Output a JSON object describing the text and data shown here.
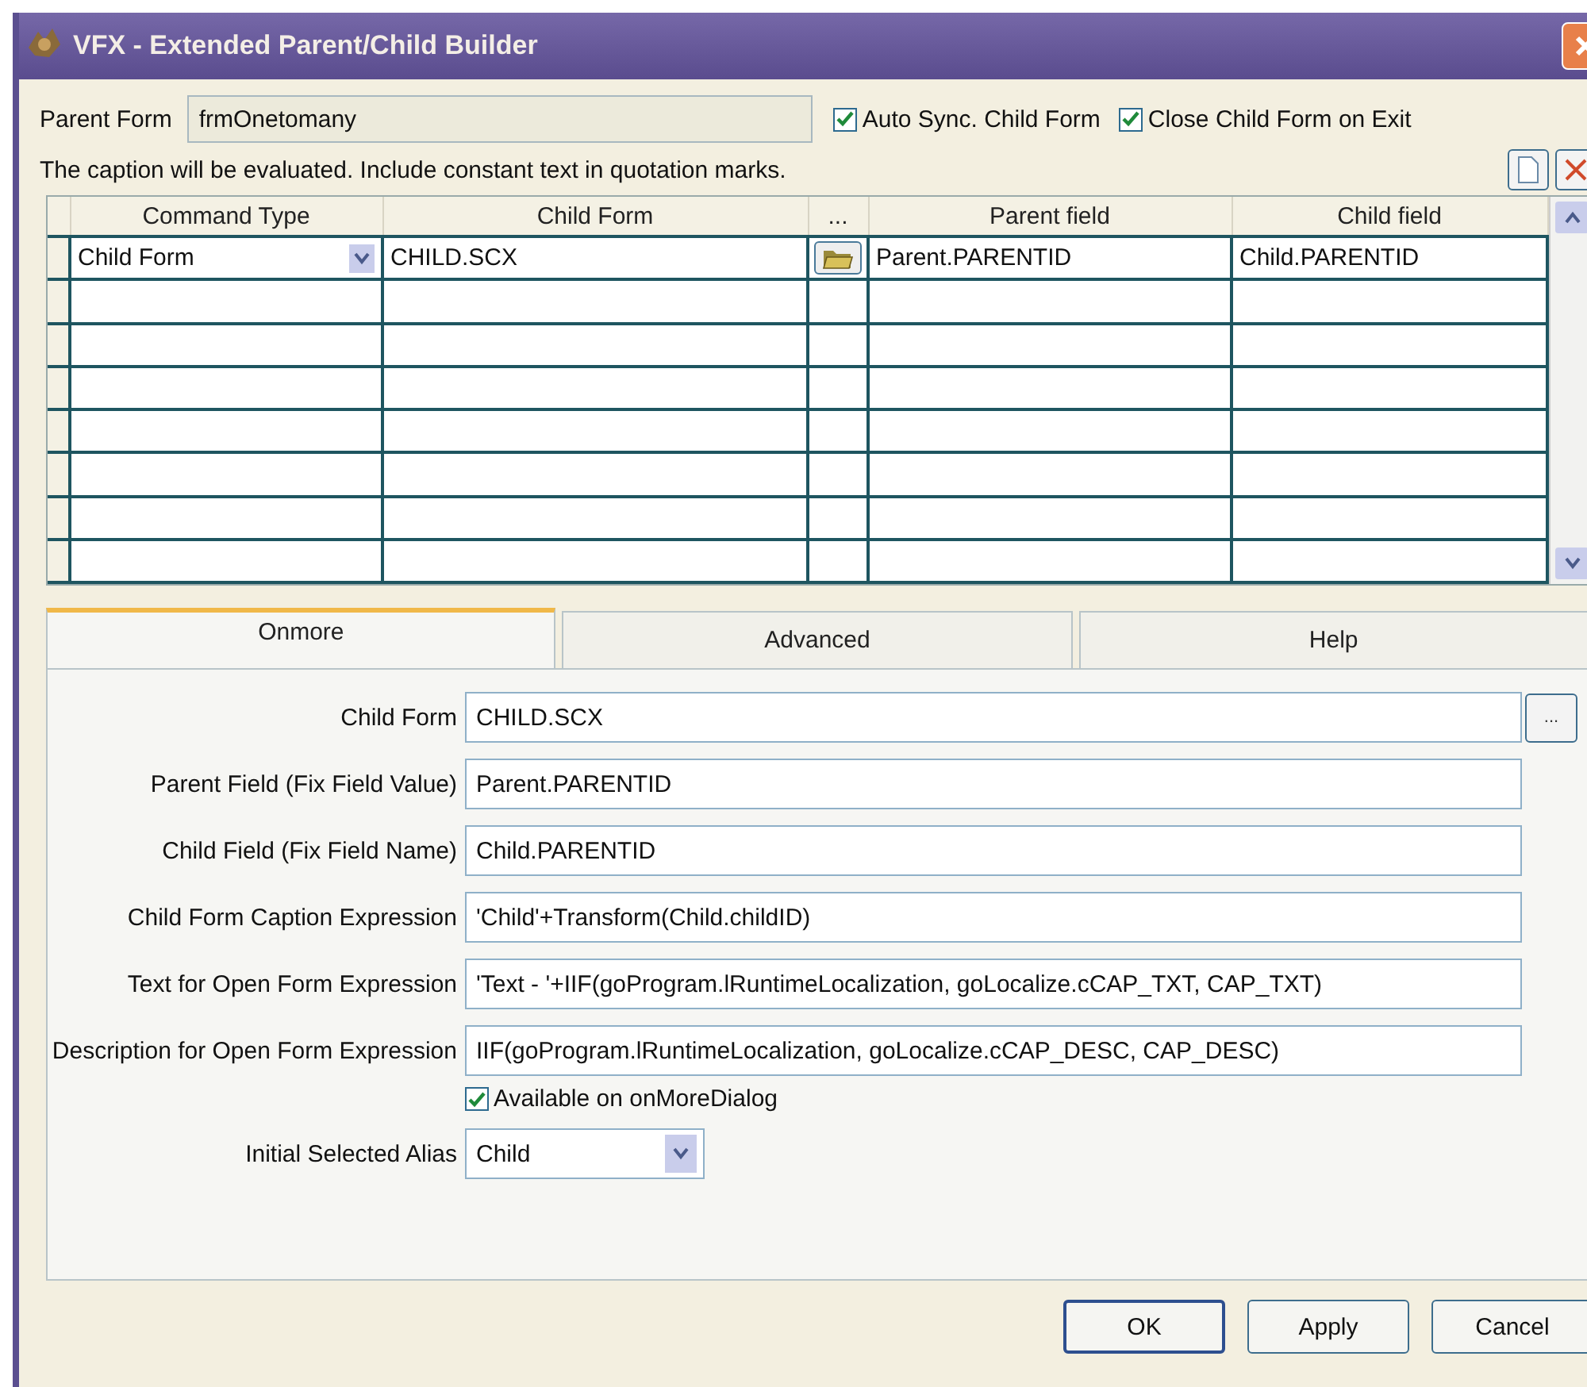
{
  "window": {
    "title": "VFX - Extended Parent/Child Builder"
  },
  "parent_form": {
    "label": "Parent Form",
    "value": "frmOnetomany"
  },
  "options": [
    {
      "label": "Auto Sync. Child Form",
      "checked": true
    },
    {
      "label": "Close Child Form on Exit",
      "checked": true
    }
  ],
  "hint": "The caption will be evaluated. Include constant text in quotation marks.",
  "grid": {
    "columns": [
      "Command Type",
      "Child Form",
      "...",
      "Parent field",
      "Child field"
    ],
    "rows": [
      {
        "command_type": "Child Form",
        "child_form": "CHILD.SCX",
        "parent_field": "Parent.PARENTID",
        "child_field": "Child.PARENTID"
      }
    ]
  },
  "tabs": [
    {
      "label": "Onmore",
      "selected": true
    },
    {
      "label": "Advanced",
      "selected": false
    },
    {
      "label": "Help",
      "selected": false
    }
  ],
  "fields": [
    {
      "kind": "text",
      "label": "Child Form",
      "value": "CHILD.SCX",
      "button": "..."
    },
    {
      "kind": "text",
      "label": "Parent Field (Fix Field Value)",
      "value": "Parent.PARENTID"
    },
    {
      "kind": "text",
      "label": "Child Field (Fix Field Name)",
      "value": "Child.PARENTID"
    },
    {
      "kind": "text",
      "label": "Child Form Caption Expression",
      "value": "'Child'+Transform(Child.childID)"
    },
    {
      "kind": "text",
      "label": "Text for Open Form Expression",
      "value": "'Text - '+IIF(goProgram.lRuntimeLocalization, goLocalize.cCAP_TXT, CAP_TXT)"
    },
    {
      "kind": "text",
      "label": "Description for Open Form Expression",
      "value": "IIF(goProgram.lRuntimeLocalization, goLocalize.cCAP_DESC, CAP_DESC)"
    },
    {
      "kind": "checkbox",
      "label": "Available on onMoreDialog",
      "checked": true
    },
    {
      "kind": "combo",
      "label": "Initial Selected Alias",
      "value": "Child"
    }
  ],
  "buttons": [
    {
      "label": "OK",
      "default": true
    },
    {
      "label": "Apply",
      "default": false
    },
    {
      "label": "Cancel",
      "default": false
    }
  ]
}
